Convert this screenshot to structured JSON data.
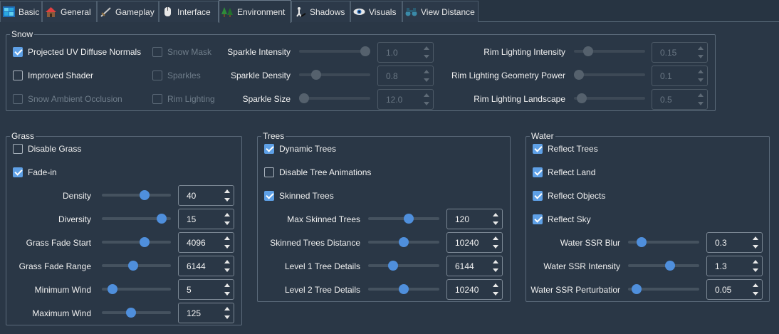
{
  "tabs": [
    {
      "label": "Basic",
      "icon": "basic-icon"
    },
    {
      "label": "General",
      "icon": "house-icon"
    },
    {
      "label": "Gameplay",
      "icon": "sword-icon"
    },
    {
      "label": "Interface",
      "icon": "mouse-icon"
    },
    {
      "label": "Environment",
      "icon": "trees-icon"
    },
    {
      "label": "Shadows",
      "icon": "shadow-figure-icon"
    },
    {
      "label": "Visuals",
      "icon": "eye-icon"
    },
    {
      "label": "View Distance",
      "icon": "binoculars-icon"
    }
  ],
  "active_tab": "Environment",
  "snow": {
    "title": "Snow",
    "projected_uv": {
      "label": "Projected UV Diffuse Normals",
      "checked": true
    },
    "improved_shader": {
      "label": "Improved Shader",
      "checked": false
    },
    "snow_ao": {
      "label": "Snow Ambient Occlusion",
      "checked": false
    },
    "snow_mask": {
      "label": "Snow Mask",
      "checked": false
    },
    "sparkles": {
      "label": "Sparkles",
      "checked": false
    },
    "rim_lighting": {
      "label": "Rim Lighting",
      "checked": false
    },
    "sparkle_intensity": {
      "label": "Sparkle Intensity",
      "value": "1.0",
      "level": 1.0
    },
    "sparkle_density": {
      "label": "Sparkle Density",
      "value": "0.8",
      "level": 0.2
    },
    "sparkle_size": {
      "label": "Sparkle Size",
      "value": "12.0",
      "level": 0.0
    },
    "rim_intensity": {
      "label": "Rim Lighting Intensity",
      "value": "0.15",
      "level": 0.15
    },
    "rim_geometry_power": {
      "label": "Rim Lighting Geometry Power",
      "value": "0.1",
      "level": 0.0
    },
    "rim_landscape": {
      "label": "Rim Lighting Landscape",
      "value": "0.5",
      "level": 0.05
    }
  },
  "grass": {
    "title": "Grass",
    "disable_grass": {
      "label": "Disable Grass",
      "checked": false
    },
    "fade_in": {
      "label": "Fade-in",
      "checked": true
    },
    "density": {
      "label": "Density",
      "value": "40",
      "level": 0.64
    },
    "diversity": {
      "label": "Diversity",
      "value": "15",
      "level": 0.93
    },
    "fade_start": {
      "label": "Grass Fade Start",
      "value": "4096",
      "level": 0.64
    },
    "fade_range": {
      "label": "Grass Fade Range",
      "value": "6144",
      "level": 0.44
    },
    "min_wind": {
      "label": "Minimum Wind",
      "value": "5",
      "level": 0.1
    },
    "max_wind": {
      "label": "Maximum Wind",
      "value": "125",
      "level": 0.41
    }
  },
  "trees": {
    "title": "Trees",
    "dynamic_trees": {
      "label": "Dynamic Trees",
      "checked": true
    },
    "disable_animations": {
      "label": "Disable Tree Animations",
      "checked": false
    },
    "skinned_trees": {
      "label": "Skinned Trees",
      "checked": true
    },
    "max_skinned": {
      "label": "Max Skinned Trees",
      "value": "120",
      "level": 0.58
    },
    "skinned_distance": {
      "label": "Skinned Trees Distance",
      "value": "10240",
      "level": 0.5
    },
    "level1": {
      "label": "Level 1 Tree Details",
      "value": "6144",
      "level": 0.32
    },
    "level2": {
      "label": "Level 2 Tree Details",
      "value": "10240",
      "level": 0.5
    }
  },
  "water": {
    "title": "Water",
    "reflect_trees": {
      "label": "Reflect Trees",
      "checked": true
    },
    "reflect_land": {
      "label": "Reflect Land",
      "checked": true
    },
    "reflect_objects": {
      "label": "Reflect Objects",
      "checked": true
    },
    "reflect_sky": {
      "label": "Reflect Sky",
      "checked": true
    },
    "ssr_blur": {
      "label": "Water SSR Blur",
      "value": "0.3",
      "level": 0.14
    },
    "ssr_intensity": {
      "label": "Water SSR Intensity",
      "value": "1.3",
      "level": 0.6
    },
    "ssr_perturbation": {
      "label": "Water SSR Perturbatior",
      "value": "0.05",
      "level": 0.06
    }
  },
  "colors": {
    "background": "#2a3746",
    "accent": "#5ea0e6",
    "knob": "#4f8fdc"
  }
}
